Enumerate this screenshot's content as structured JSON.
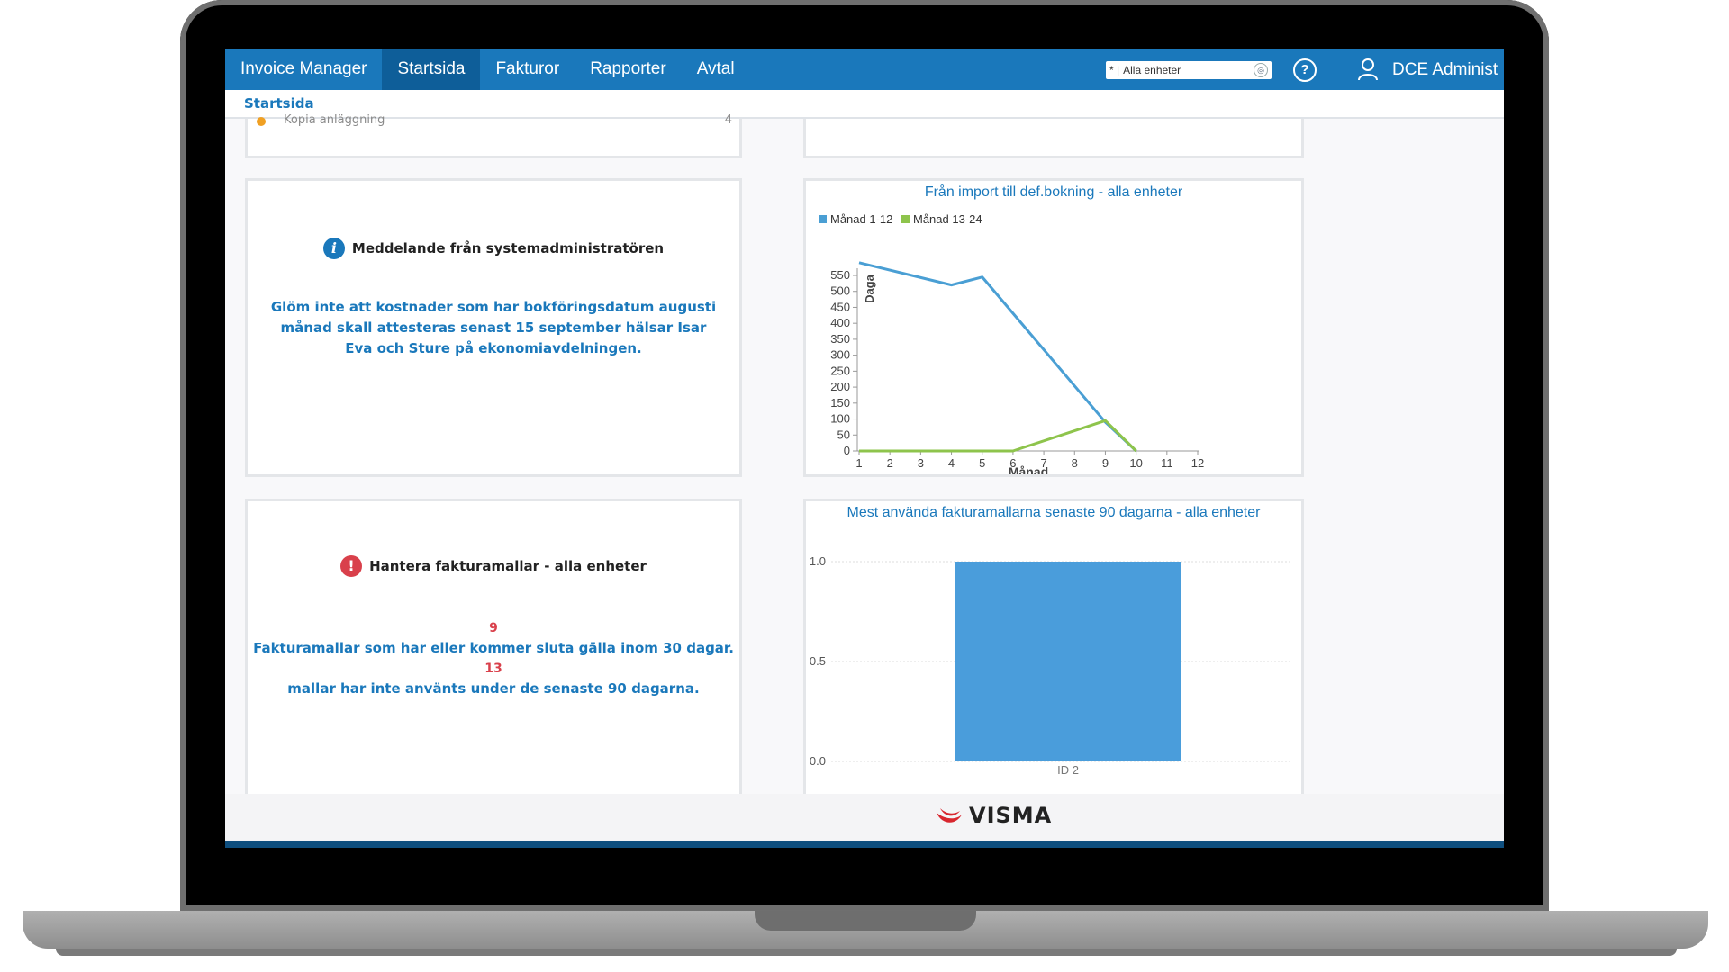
{
  "nav": {
    "brand": "Invoice Manager",
    "items": [
      {
        "label": "Startsida",
        "active": true
      },
      {
        "label": "Fakturor",
        "active": false
      },
      {
        "label": "Rapporter",
        "active": false
      },
      {
        "label": "Avtal",
        "active": false
      }
    ],
    "unit_select": {
      "prefix": "* |",
      "value": "Alla enheter"
    },
    "user_name": "DCE Administ"
  },
  "breadcrumb": "Startsida",
  "prev_list_item": {
    "label": "Kopia anläggning",
    "count": "4"
  },
  "message_panel": {
    "heading": "Meddelande från systemadministratören",
    "text": "Glöm inte att kostnader som har bokföringsdatum augusti månad skall attesteras senast 15 september hälsar Isar Eva och Sture på ekonomiavdelningen."
  },
  "templates_panel": {
    "heading": "Hantera fakturamallar - alla enheter",
    "count_expiring": "9",
    "text_expiring": "Fakturamallar som har eller kommer sluta gälla inom 30 dagar.",
    "count_unused": "13",
    "text_unused": "mallar har inte använts under de senaste 90 dagarna."
  },
  "footer": {
    "logo_text": "VISMA"
  },
  "colors": {
    "nav": "#1a78bb",
    "nav_active": "#0e5e99",
    "series1": "#4a9fd4",
    "series2": "#8ec44c",
    "bar": "#4a9ddb",
    "warn": "#d9404b"
  },
  "chart_data": [
    {
      "type": "line",
      "title": "Från import till def.bokning - alla enheter",
      "xlabel": "Månad",
      "ylabel": "Daga",
      "x": [
        1,
        2,
        3,
        4,
        5,
        6,
        7,
        8,
        9,
        10,
        11,
        12
      ],
      "series": [
        {
          "name": "Månad 1-12",
          "color": "#4a9fd4",
          "x": [
            1,
            4,
            5,
            9,
            10
          ],
          "values": [
            590,
            520,
            545,
            90,
            0
          ]
        },
        {
          "name": "Månad 13-24",
          "color": "#8ec44c",
          "x": [
            1,
            2,
            3,
            4,
            5,
            6,
            9,
            10
          ],
          "values": [
            0,
            0,
            0,
            0,
            0,
            0,
            95,
            0
          ]
        }
      ],
      "ylim": [
        0,
        550
      ],
      "yticks": [
        0,
        50,
        100,
        150,
        200,
        250,
        300,
        350,
        400,
        450,
        500,
        550
      ],
      "legend": "top-left"
    },
    {
      "type": "bar",
      "title": "Mest använda fakturamallarna senaste 90 dagarna - alla enheter",
      "categories": [
        "ID 2"
      ],
      "values": [
        1.0
      ],
      "ylim": [
        0,
        1.0
      ],
      "yticks": [
        "0.0",
        "0.5",
        "1.0"
      ],
      "color": "#4a9ddb"
    }
  ]
}
